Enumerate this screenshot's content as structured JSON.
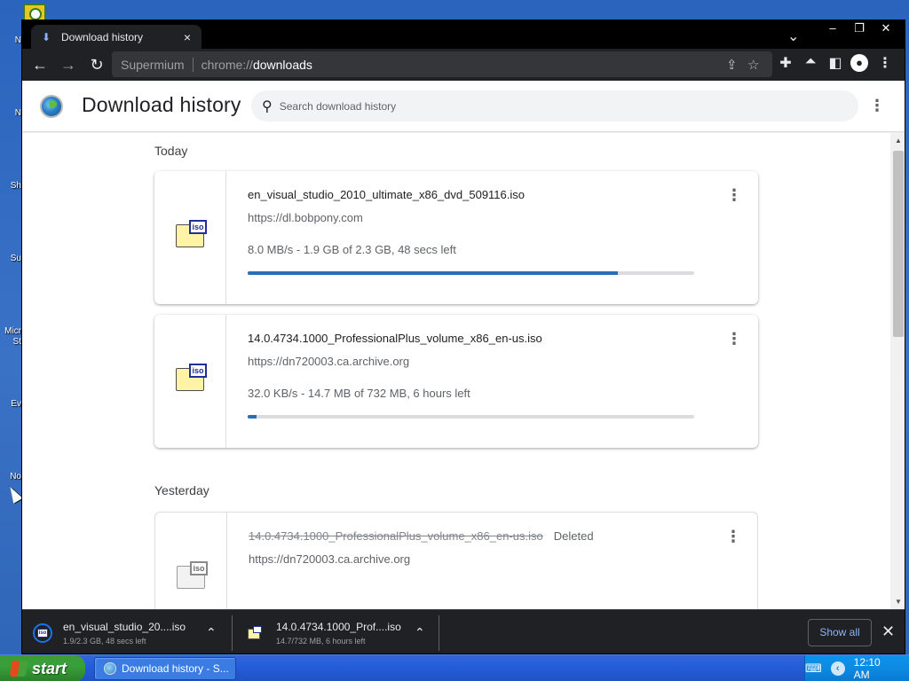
{
  "desktop": {
    "labels": [
      "N",
      "N",
      "Sh",
      "Su",
      "Micr St",
      "Ev",
      "No"
    ]
  },
  "browser": {
    "tab_title": "Download history",
    "tab_close": "×",
    "window_controls": [
      "–",
      "❐",
      "✕"
    ],
    "tab_dropdown": "⌄",
    "omnibox": {
      "site_name": "Supermium",
      "url_scheme": "chrome://",
      "url_host": "downloads"
    }
  },
  "page": {
    "title": "Download history",
    "search_placeholder": "Search download history",
    "sections": {
      "today": "Today",
      "yesterday": "Yesterday"
    },
    "downloads": [
      {
        "filename": "en_visual_studio_2010_ultimate_x86_dvd_509116.iso",
        "url": "https://dl.bobpony.com",
        "status": "8.0 MB/s - 1.9 GB of 2.3 GB, 48 secs left",
        "progress": 0.83,
        "icon": "iso-file-icon"
      },
      {
        "filename": "14.0.4734.1000_ProfessionalPlus_volume_x86_en-us.iso",
        "url": "https://dn720003.ca.archive.org",
        "status": "32.0 KB/s - 14.7 MB of 732 MB, 6 hours left",
        "progress": 0.02,
        "icon": "iso-file-icon"
      },
      {
        "filename": "14.0.4734.1000_ProfessionalPlus_volume_x86_en-us.iso",
        "url": "https://dn720003.ca.archive.org",
        "state": "Deleted",
        "icon": "iso-file-icon-grey"
      }
    ]
  },
  "shelf": {
    "items": [
      {
        "name": "en_visual_studio_20....iso",
        "sub": "1.9/2.3 GB, 48 secs left"
      },
      {
        "name": "14.0.4734.1000_Prof....iso",
        "sub": "14.7/732 MB, 6 hours left"
      }
    ],
    "show_all": "Show all",
    "close": "✕"
  },
  "taskbar": {
    "start_label": "start",
    "task_title": "Download history - S...",
    "clock": "12:10 AM"
  },
  "colors": {
    "progress_fill": "#2a6db8",
    "progress_track": "#dadce0",
    "toolbar_bg": "#202124",
    "taskbar_blue": "#245edb",
    "start_green": "#38a03a"
  }
}
